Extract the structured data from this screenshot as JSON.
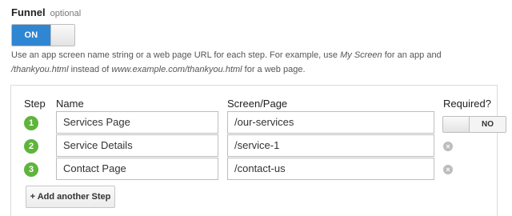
{
  "funnel": {
    "title": "Funnel",
    "optional_label": "optional",
    "toggle_label": "ON"
  },
  "help": {
    "part1": "Use an app screen name string or a web page URL for each step. For example, use ",
    "example1": "My Screen",
    "part2": " for an app and ",
    "example2": "/thankyou.html",
    "part3": " instead of ",
    "example3": "www.example.com/thankyou.html",
    "part4": " for a web page."
  },
  "columns": {
    "step": "Step",
    "name": "Name",
    "screen": "Screen/Page",
    "required": "Required?"
  },
  "steps": [
    {
      "number": "1",
      "name": "Services Page",
      "screen": "/our-services"
    },
    {
      "number": "2",
      "name": "Service Details",
      "screen": "/service-1"
    },
    {
      "number": "3",
      "name": "Contact Page",
      "screen": "/contact-us"
    }
  ],
  "required_toggle_label": "NO",
  "remove_icon_glyph": "×",
  "add_step_label": "+ Add another Step",
  "colors": {
    "accent": "#2f86d3",
    "step_badge": "#5fb43b"
  }
}
